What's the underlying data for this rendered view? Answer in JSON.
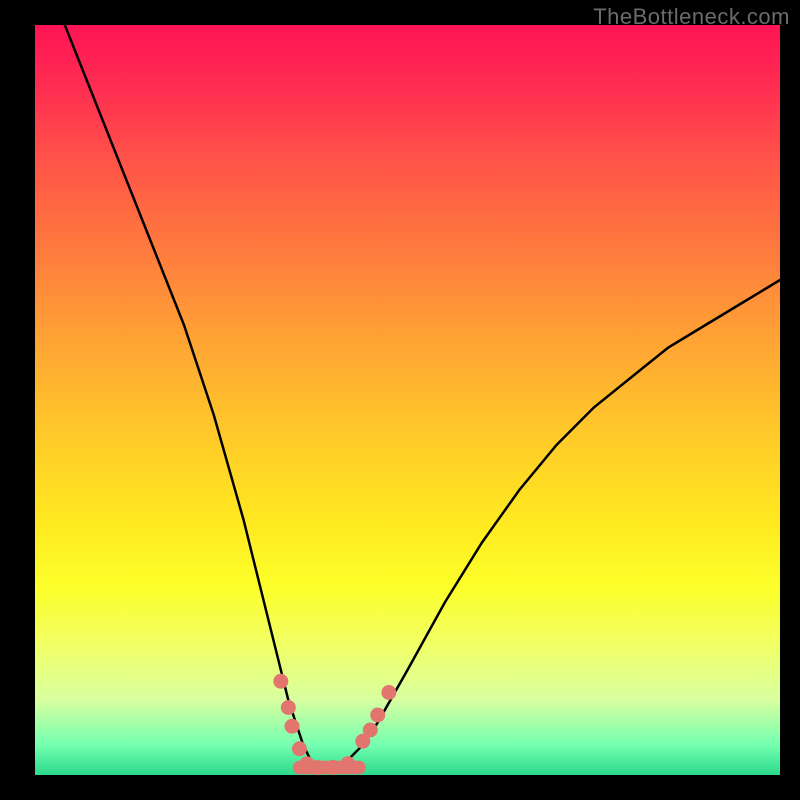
{
  "watermark": "TheBottleneck.com",
  "chart_data": {
    "type": "line",
    "title": "",
    "xlabel": "",
    "ylabel": "",
    "xlim": [
      0,
      100
    ],
    "ylim": [
      0,
      100
    ],
    "series": [
      {
        "name": "bottleneck-curve",
        "x": [
          4,
          8,
          12,
          16,
          20,
          24,
          28,
          30,
          32,
          34,
          36,
          37,
          38,
          39,
          40,
          42,
          44,
          46,
          50,
          55,
          60,
          65,
          70,
          75,
          80,
          85,
          90,
          95,
          100
        ],
        "y": [
          100,
          90,
          80,
          70,
          60,
          48,
          34,
          26,
          18,
          10,
          4,
          2,
          1,
          1,
          1,
          2,
          4,
          7,
          14,
          23,
          31,
          38,
          44,
          49,
          53,
          57,
          60,
          63,
          66
        ]
      }
    ],
    "highlight_points": {
      "name": "marker-dots",
      "color": "#e2766f",
      "points": [
        {
          "x": 33.0,
          "y": 12.5
        },
        {
          "x": 34.0,
          "y": 9.0
        },
        {
          "x": 34.5,
          "y": 6.5
        },
        {
          "x": 35.5,
          "y": 3.5
        },
        {
          "x": 36.5,
          "y": 1.5
        },
        {
          "x": 38.0,
          "y": 1.0
        },
        {
          "x": 40.0,
          "y": 1.0
        },
        {
          "x": 42.0,
          "y": 1.5
        },
        {
          "x": 44.0,
          "y": 4.5
        },
        {
          "x": 45.0,
          "y": 6.0
        },
        {
          "x": 46.0,
          "y": 8.0
        },
        {
          "x": 47.5,
          "y": 11.0
        }
      ]
    },
    "bottom_band": {
      "name": "bottom-highlight-band",
      "color": "#e2766f",
      "x_start": 35.5,
      "x_end": 43.5,
      "y": 1.0,
      "thickness": 1.8
    }
  }
}
